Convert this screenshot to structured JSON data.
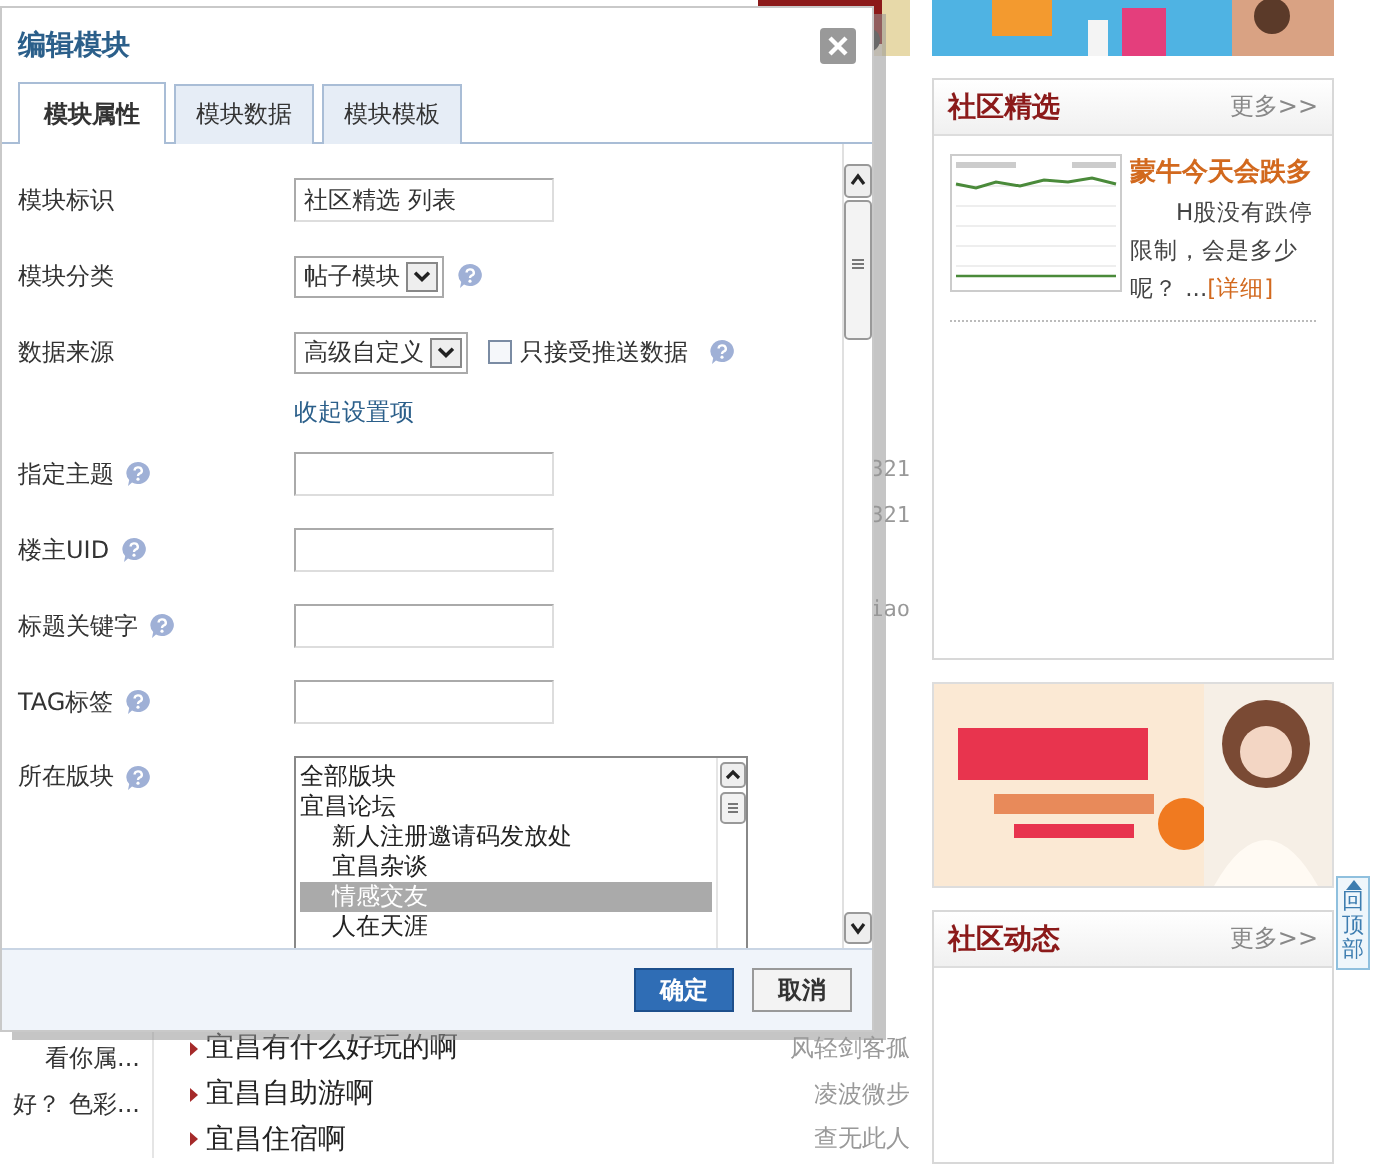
{
  "dialog": {
    "title": "编辑模块",
    "tabs": [
      {
        "label": "模块属性",
        "selected": true
      },
      {
        "label": "模块数据",
        "selected": false
      },
      {
        "label": "模块模板",
        "selected": false
      }
    ],
    "fields": [
      {
        "kind": "text",
        "label": "模块标识",
        "value": "社区精选 列表",
        "help": false
      },
      {
        "kind": "select",
        "label": "模块分类",
        "value": "帖子模块",
        "help": true
      },
      {
        "kind": "select",
        "label": "数据来源",
        "value": "高级自定义",
        "help": false,
        "checkbox": {
          "label": "只接受推送数据",
          "checked": false,
          "help": true
        }
      },
      {
        "kind": "link",
        "label": "收起设置项"
      },
      {
        "kind": "text",
        "label": "指定主题",
        "help": true
      },
      {
        "kind": "text",
        "label": "楼主UID",
        "help": true
      },
      {
        "kind": "text",
        "label": "标题关键字",
        "help": true
      },
      {
        "kind": "text",
        "label": "TAG标签",
        "help": true
      },
      {
        "kind": "list",
        "label": "所在版块",
        "help": true,
        "options": [
          {
            "label": "全部版块",
            "selected": false
          },
          {
            "label": "宜昌论坛",
            "selected": false,
            "children": [
              {
                "label": "新人注册邀请码发放处",
                "selected": false
              },
              {
                "label": "宜昌杂谈",
                "selected": false
              },
              {
                "label": "情感交友",
                "selected": true
              },
              {
                "label": "人在天涯",
                "selected": false
              }
            ]
          }
        ]
      }
    ],
    "buttons": [
      {
        "label": "确定",
        "kind": "primary"
      },
      {
        "label": "取消",
        "kind": "secondary"
      }
    ]
  },
  "background": {
    "side_strip": [
      "321",
      "321",
      "iao"
    ],
    "left_items": [
      "看你属...",
      "好？ 色彩..."
    ],
    "threads": [
      {
        "title": "宜昌有什么好玩的啊",
        "author": "风轻剑客孤"
      },
      {
        "title": "宜昌自助游啊",
        "author": "凌波微步"
      },
      {
        "title": "宜昌住宿啊",
        "author": "查无此人"
      }
    ]
  },
  "sidebar": [
    {
      "kind": "article",
      "title": "社区精选",
      "more": "更多>>",
      "article": {
        "title": "蒙牛今天会跌多",
        "summary": "H股没有跌停限制，会是多少呢？ ...",
        "link": "[详细]"
      }
    },
    {
      "kind": "ad"
    },
    {
      "kind": "panel",
      "title": "社区动态",
      "more": "更多>>"
    }
  ],
  "back_to_top": "回顶部"
}
